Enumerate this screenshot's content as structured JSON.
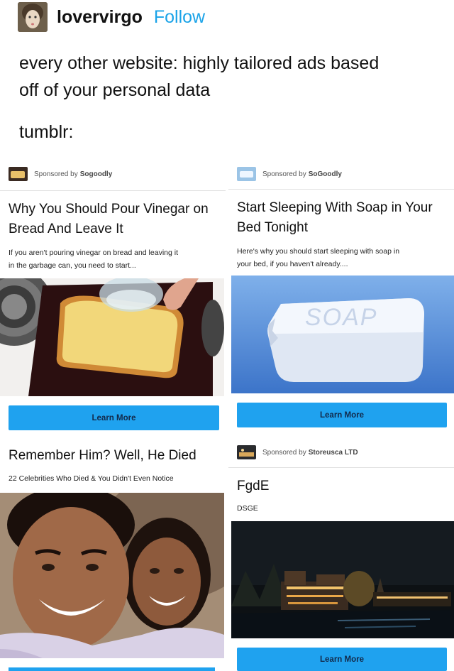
{
  "header": {
    "username": "lovervirgo",
    "follow_label": "Follow"
  },
  "post": {
    "line1": "every other website: highly tailored ads based",
    "line2": "off of your personal data",
    "line3": "tumblr:"
  },
  "ads": [
    {
      "sponsor_prefix": "Sponsored by",
      "sponsor_name": "Sogoodly",
      "title_line1": "Why You Should Pour Vinegar on",
      "title_line2": "Bread And Leave It",
      "desc_line1": "If you aren't pouring vinegar on bread and leaving it",
      "desc_line2": "in the garbage can, you need to start...",
      "cta": "Learn More"
    },
    {
      "sponsor_prefix": "Sponsored by",
      "sponsor_name": "SoGoodly",
      "title_line1": "Start Sleeping With Soap in Your",
      "title_line2": "Bed Tonight",
      "desc_line1": "Here's why you should start sleeping with soap in",
      "desc_line2": "your bed, if you haven't already....",
      "image_text": "SOAP",
      "cta": "Learn More"
    },
    {
      "title_line1": "Remember Him? Well, He Died",
      "desc_line1": "22 Celebrities Who Died & You Didn't Even Notice"
    },
    {
      "sponsor_prefix": "Sponsored by",
      "sponsor_name": "Storeusca LTD",
      "title_line1": "FgdE",
      "desc_line1": "DSGE",
      "cta": "Learn More"
    }
  ]
}
